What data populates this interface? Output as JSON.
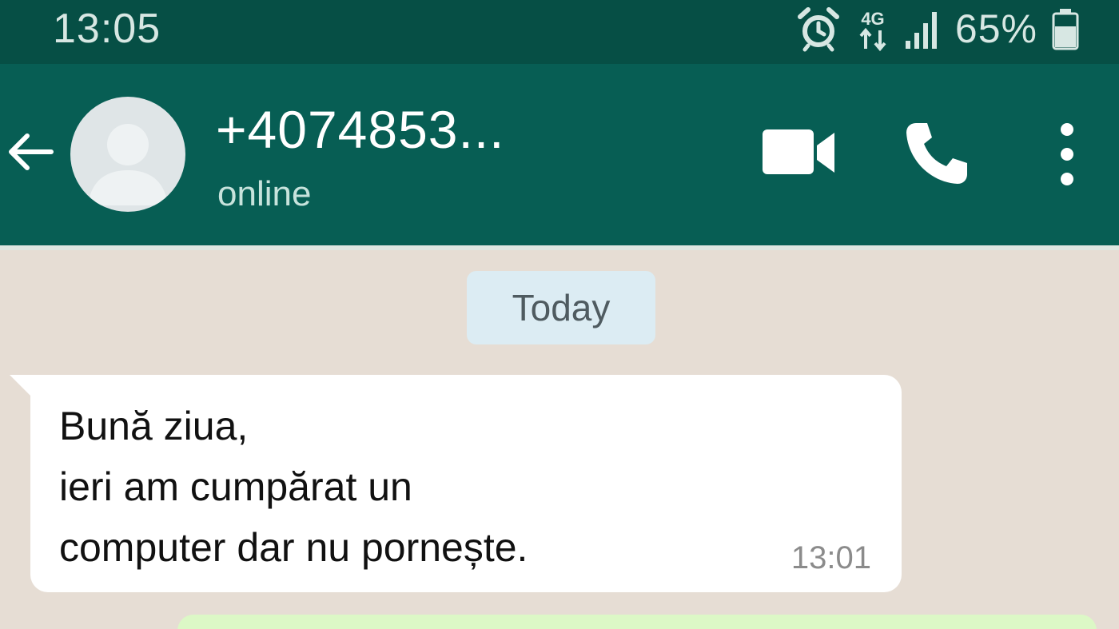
{
  "status_bar": {
    "time": "13:05",
    "network": "4G",
    "battery_percent": "65%",
    "icons": [
      "alarm-icon",
      "data-arrows-icon",
      "signal-icon",
      "battery-icon"
    ]
  },
  "header": {
    "contact_name": "+4074853...",
    "contact_status": "online",
    "icons": [
      "back-arrow-icon",
      "avatar-placeholder-icon",
      "video-call-icon",
      "phone-icon",
      "more-vert-icon"
    ]
  },
  "chat": {
    "date_separator": "Today",
    "messages": [
      {
        "direction": "incoming",
        "lines": [
          "Bună ziua,",
          "ieri am cumpărat un",
          "computer dar nu pornește."
        ],
        "time": "13:01"
      }
    ]
  },
  "colors": {
    "status_bar": "#064f45",
    "header": "#075e54",
    "chat_background": "#e6ddd4",
    "incoming_bubble": "#ffffff",
    "outgoing_bubble": "#dcf8c6",
    "date_chip": "#dcecf3"
  }
}
